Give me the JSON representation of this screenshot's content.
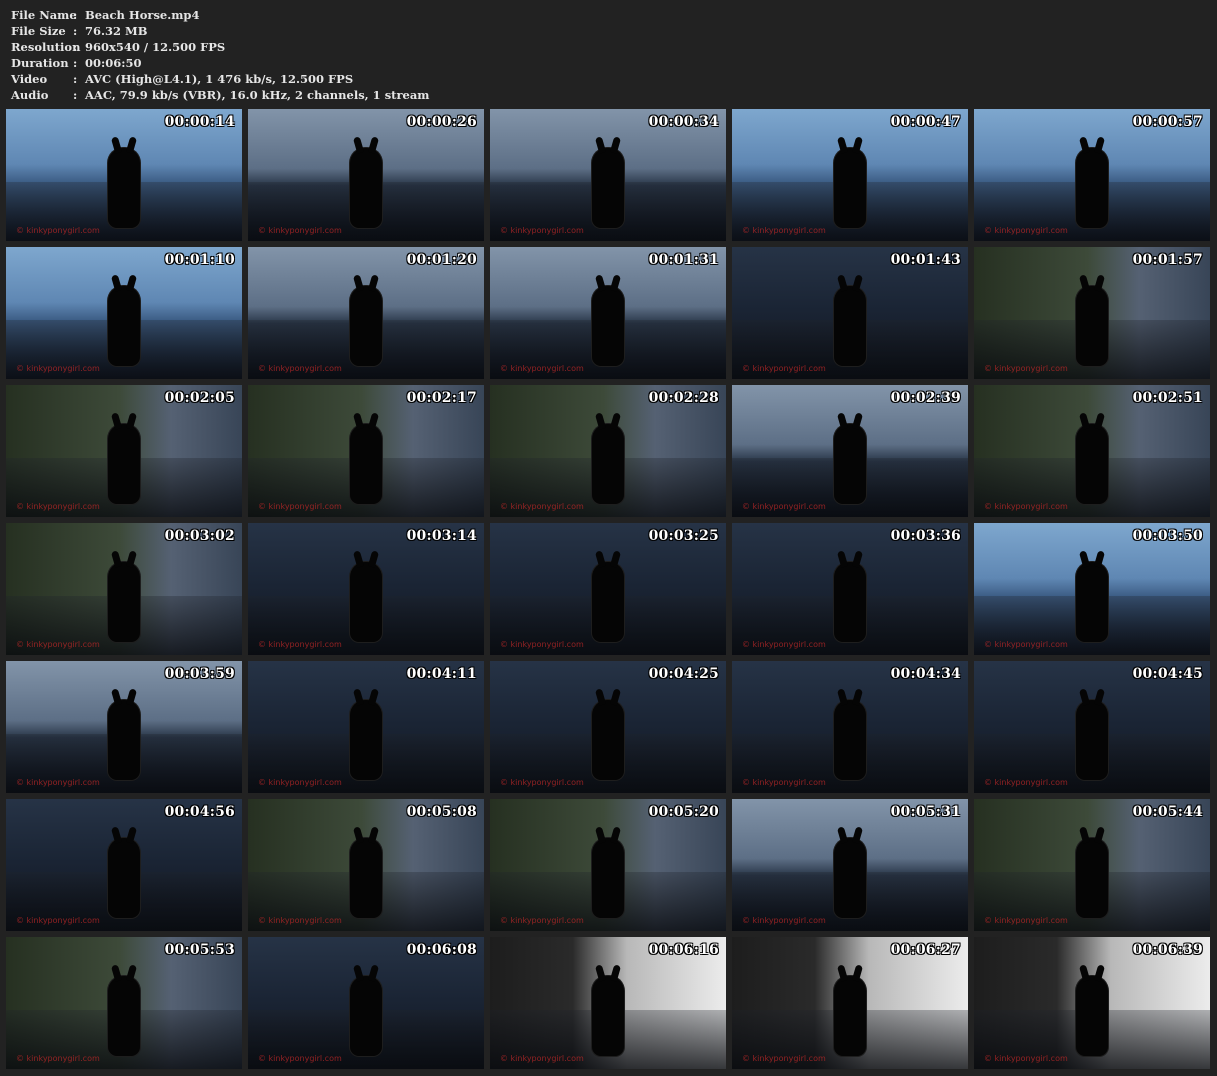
{
  "info": [
    {
      "label": "File Name",
      "sep": ":",
      "value": "Beach Horse.mp4"
    },
    {
      "label": "File Size",
      "sep": ":",
      "value": "76.32 MB"
    },
    {
      "label": "Resolution",
      "sep": ":",
      "value": "960x540 / 12.500 FPS"
    },
    {
      "label": "Duration",
      "sep": ":",
      "value": "00:06:50"
    },
    {
      "label": "Video",
      "sep": ":",
      "value": "AVC (High@L4.1), 1 476 kb/s, 12.500 FPS"
    },
    {
      "label": "Audio",
      "sep": ":",
      "value": "AAC, 79.9 kb/s (VBR), 16.0 kHz, 2 channels, 1 stream"
    }
  ],
  "thumbnails": [
    {
      "time": "00:00:14",
      "watermark": "© kinkyponygirl.com",
      "theme": "t-sky-bright"
    },
    {
      "time": "00:00:26",
      "watermark": "© kinkyponygirl.com",
      "theme": "t-dawn"
    },
    {
      "time": "00:00:34",
      "watermark": "© kinkyponygirl.com",
      "theme": "t-dawn"
    },
    {
      "time": "00:00:47",
      "watermark": "© kinkyponygirl.com",
      "theme": "t-sky-bright"
    },
    {
      "time": "00:00:57",
      "watermark": "© kinkyponygirl.com",
      "theme": "t-sky-bright"
    },
    {
      "time": "00:01:10",
      "watermark": "© kinkyponygirl.com",
      "theme": "t-sky-bright"
    },
    {
      "time": "00:01:20",
      "watermark": "© kinkyponygirl.com",
      "theme": "t-dawn"
    },
    {
      "time": "00:01:31",
      "watermark": "© kinkyponygirl.com",
      "theme": "t-dawn"
    },
    {
      "time": "00:01:43",
      "watermark": "© kinkyponygirl.com",
      "theme": "t-dark"
    },
    {
      "time": "00:01:57",
      "watermark": "© kinkyponygirl.com",
      "theme": "t-cliff"
    },
    {
      "time": "00:02:05",
      "watermark": "© kinkyponygirl.com",
      "theme": "t-cliff"
    },
    {
      "time": "00:02:17",
      "watermark": "© kinkyponygirl.com",
      "theme": "t-cliff"
    },
    {
      "time": "00:02:28",
      "watermark": "© kinkyponygirl.com",
      "theme": "t-cliff"
    },
    {
      "time": "00:02:39",
      "watermark": "© kinkyponygirl.com",
      "theme": "t-dawn"
    },
    {
      "time": "00:02:51",
      "watermark": "© kinkyponygirl.com",
      "theme": "t-cliff"
    },
    {
      "time": "00:03:02",
      "watermark": "© kinkyponygirl.com",
      "theme": "t-cliff"
    },
    {
      "time": "00:03:14",
      "watermark": "© kinkyponygirl.com",
      "theme": "t-dark"
    },
    {
      "time": "00:03:25",
      "watermark": "© kinkyponygirl.com",
      "theme": "t-dark"
    },
    {
      "time": "00:03:36",
      "watermark": "© kinkyponygirl.com",
      "theme": "t-dark"
    },
    {
      "time": "00:03:50",
      "watermark": "© kinkyponygirl.com",
      "theme": "t-sky-bright"
    },
    {
      "time": "00:03:59",
      "watermark": "© kinkyponygirl.com",
      "theme": "t-dawn"
    },
    {
      "time": "00:04:11",
      "watermark": "© kinkyponygirl.com",
      "theme": "t-dark"
    },
    {
      "time": "00:04:25",
      "watermark": "© kinkyponygirl.com",
      "theme": "t-dark"
    },
    {
      "time": "00:04:34",
      "watermark": "© kinkyponygirl.com",
      "theme": "t-dark"
    },
    {
      "time": "00:04:45",
      "watermark": "© kinkyponygirl.com",
      "theme": "t-dark"
    },
    {
      "time": "00:04:56",
      "watermark": "© kinkyponygirl.com",
      "theme": "t-dark"
    },
    {
      "time": "00:05:08",
      "watermark": "© kinkyponygirl.com",
      "theme": "t-cliff"
    },
    {
      "time": "00:05:20",
      "watermark": "© kinkyponygirl.com",
      "theme": "t-cliff"
    },
    {
      "time": "00:05:31",
      "watermark": "© kinkyponygirl.com",
      "theme": "t-dawn"
    },
    {
      "time": "00:05:44",
      "watermark": "© kinkyponygirl.com",
      "theme": "t-cliff"
    },
    {
      "time": "00:05:53",
      "watermark": "© kinkyponygirl.com",
      "theme": "t-cliff"
    },
    {
      "time": "00:06:08",
      "watermark": "© kinkyponygirl.com",
      "theme": "t-dark"
    },
    {
      "time": "00:06:16",
      "watermark": "© kinkyponygirl.com",
      "theme": "t-sunset"
    },
    {
      "time": "00:06:27",
      "watermark": "© kinkyponygirl.com",
      "theme": "t-sunset"
    },
    {
      "time": "00:06:39",
      "watermark": "© kinkyponygirl.com",
      "theme": "t-sunset"
    }
  ]
}
